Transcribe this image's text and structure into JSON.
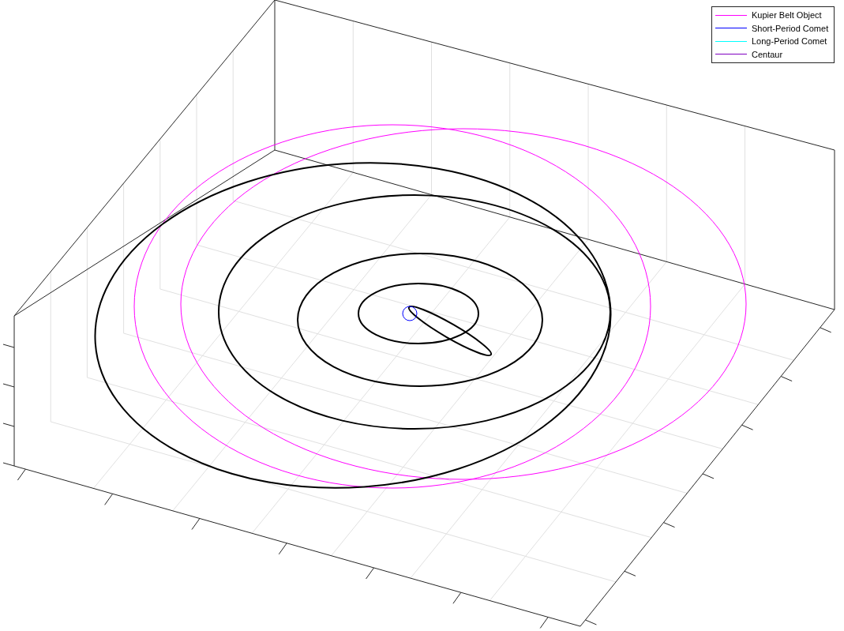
{
  "legend": [
    {
      "label": "Kupier Belt Object",
      "color": "#ff00ff"
    },
    {
      "label": "Short-Period Comet",
      "color": "#0000ff"
    },
    {
      "label": "Long-Period Comet",
      "color": "#00ffff"
    },
    {
      "label": "Centaur",
      "color": "#8000c0"
    }
  ]
}
